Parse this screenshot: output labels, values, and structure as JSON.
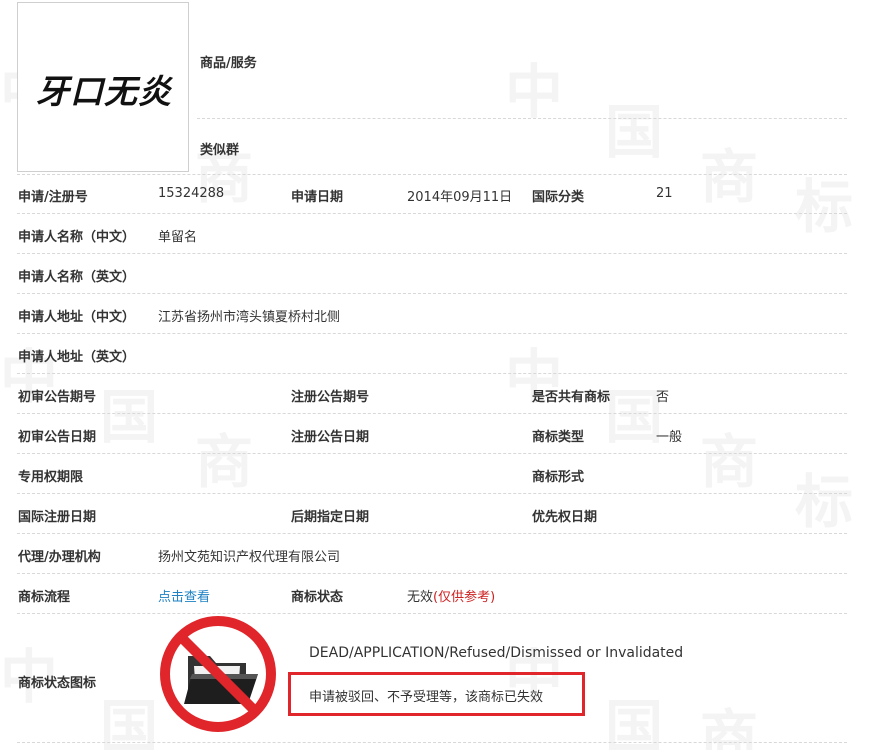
{
  "trademark": {
    "logo_text": "牙口无炎"
  },
  "watermark": {
    "chars": [
      "中",
      "国",
      "商",
      "标"
    ]
  },
  "header": {
    "goods_label": "商品/服务",
    "similar_group_label": "类似群"
  },
  "fields": {
    "reg_no_label": "申请/注册号",
    "reg_no_value": "15324288",
    "app_date_label": "申请日期",
    "app_date_value": "2014年09月11日",
    "intl_class_label": "国际分类",
    "intl_class_value": "21",
    "applicant_cn_label": "申请人名称（中文）",
    "applicant_cn_value": "单留名",
    "applicant_en_label": "申请人名称（英文）",
    "address_cn_label": "申请人地址（中文）",
    "address_cn_value": "江苏省扬州市湾头镇夏桥村北侧",
    "address_en_label": "申请人地址（英文）",
    "prelim_issue_label": "初审公告期号",
    "reg_issue_label": "注册公告期号",
    "shared_label": "是否共有商标",
    "shared_value": "否",
    "prelim_date_label": "初审公告日期",
    "reg_date_label": "注册公告日期",
    "tm_type_label": "商标类型",
    "tm_type_value": "一般",
    "exclusive_period_label": "专用权期限",
    "tm_form_label": "商标形式",
    "intl_reg_date_label": "国际注册日期",
    "later_designation_label": "后期指定日期",
    "priority_date_label": "优先权日期",
    "agent_label": "代理/办理机构",
    "agent_value": "扬州文苑知识产权代理有限公司",
    "process_label": "商标流程",
    "process_link": "点击查看",
    "status_label": "商标状态",
    "status_value": "无效",
    "status_note": "(仅供参考)",
    "status_icon_label": "商标状态图标",
    "status_en": "DEAD/APPLICATION/Refused/Dismissed or Invalidated",
    "status_cn": "申请被驳回、不予受理等，该商标已失效"
  },
  "colors": {
    "highlight_box": "#e0262b",
    "prohibited_sign": "#e0262b",
    "link": "#1f82c4",
    "note": "#cc2222"
  },
  "icons": {
    "status_icon": "folder-prohibited-icon"
  }
}
